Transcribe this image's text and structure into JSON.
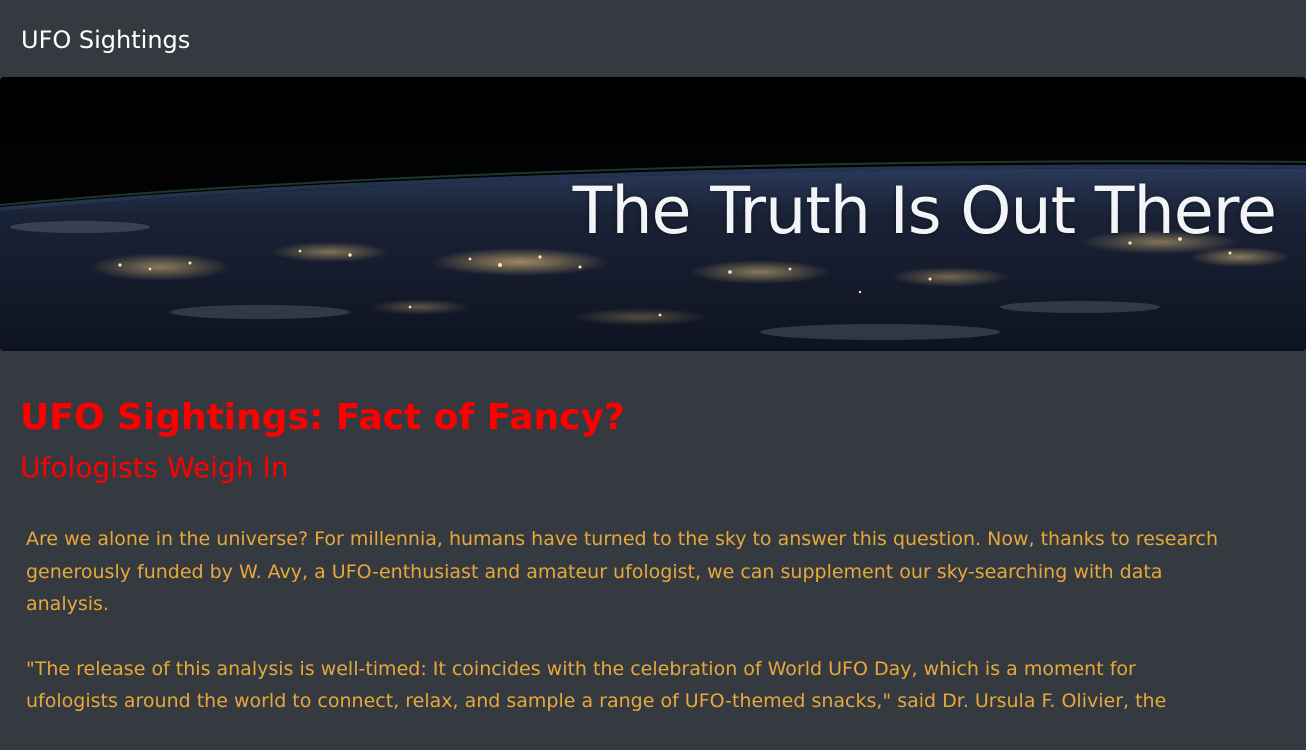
{
  "navbar": {
    "brand": "UFO Sightings"
  },
  "hero": {
    "title": "The Truth Is Out There",
    "image_subject": "earth-at-night-from-space"
  },
  "article": {
    "headline": "UFO Sightings: Fact of Fancy?",
    "subheadline": "Ufologists Weigh In",
    "paragraphs": [
      "Are we alone in the universe? For millennia, humans have turned to the sky to answer this question. Now, thanks to research generously funded by W. Avy, a UFO-enthusiast and amateur ufologist, we can supplement our sky-searching with data analysis.",
      "\"The release of this analysis is well-timed: It coincides with the celebration of World UFO Day, which is a moment for ufologists around the world to connect, relax, and sample a range of UFO-themed snacks,\" said Dr. Ursula F. Olivier, the"
    ]
  },
  "colors": {
    "background": "#343a40",
    "headline": "#ff0000",
    "body_text": "#e7a83a",
    "brand_text": "#ffffff"
  }
}
